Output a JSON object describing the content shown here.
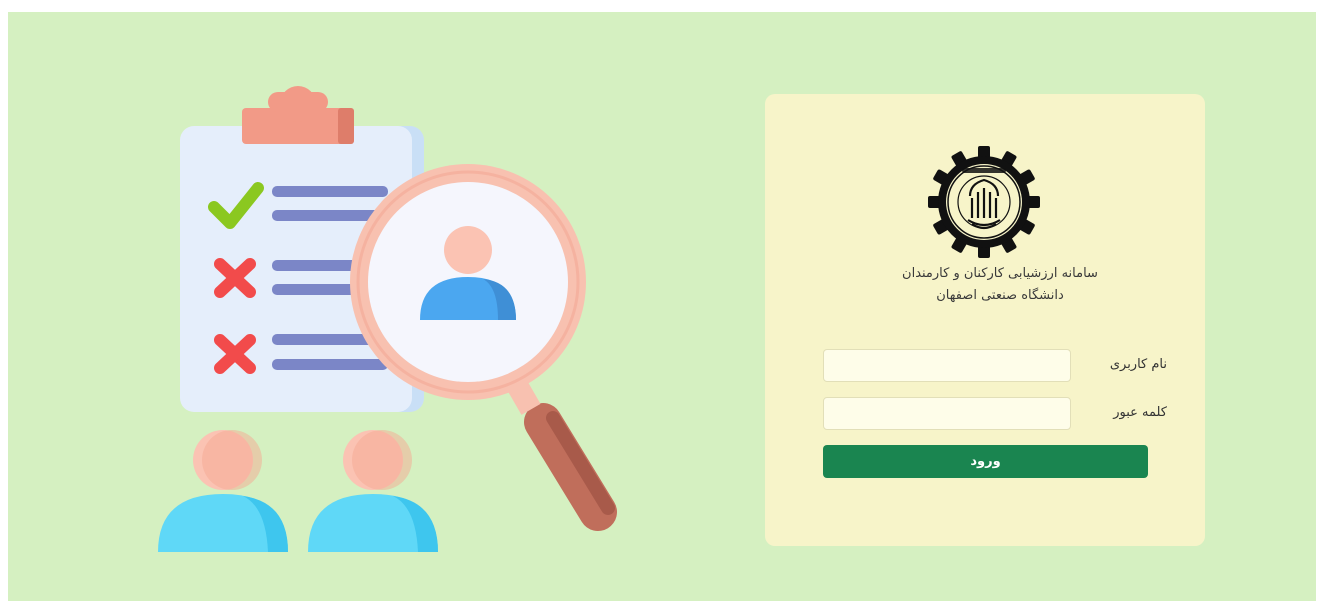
{
  "login": {
    "title_line1": "سامانه ارزشیابی کارکنان و کارمندان",
    "title_line2": "دانشگاه صنعتی اصفهان",
    "username_label": "نام کاربری",
    "username_value": "",
    "password_label": "کلمه عبور",
    "password_value": "",
    "submit_label": "ورود"
  },
  "colors": {
    "page_bg": "#d5f0c1",
    "card_bg": "#f7f4c9",
    "button": "#1a8550",
    "accent_check": "#8bc820",
    "accent_cross": "#f24b4b",
    "person": "#5fc8f5",
    "magnifier_ring": "#f8c1b0"
  },
  "icons": [
    "clipboard-icon",
    "check-icon",
    "cross-icon",
    "magnifier-icon",
    "person-icon",
    "university-logo"
  ]
}
